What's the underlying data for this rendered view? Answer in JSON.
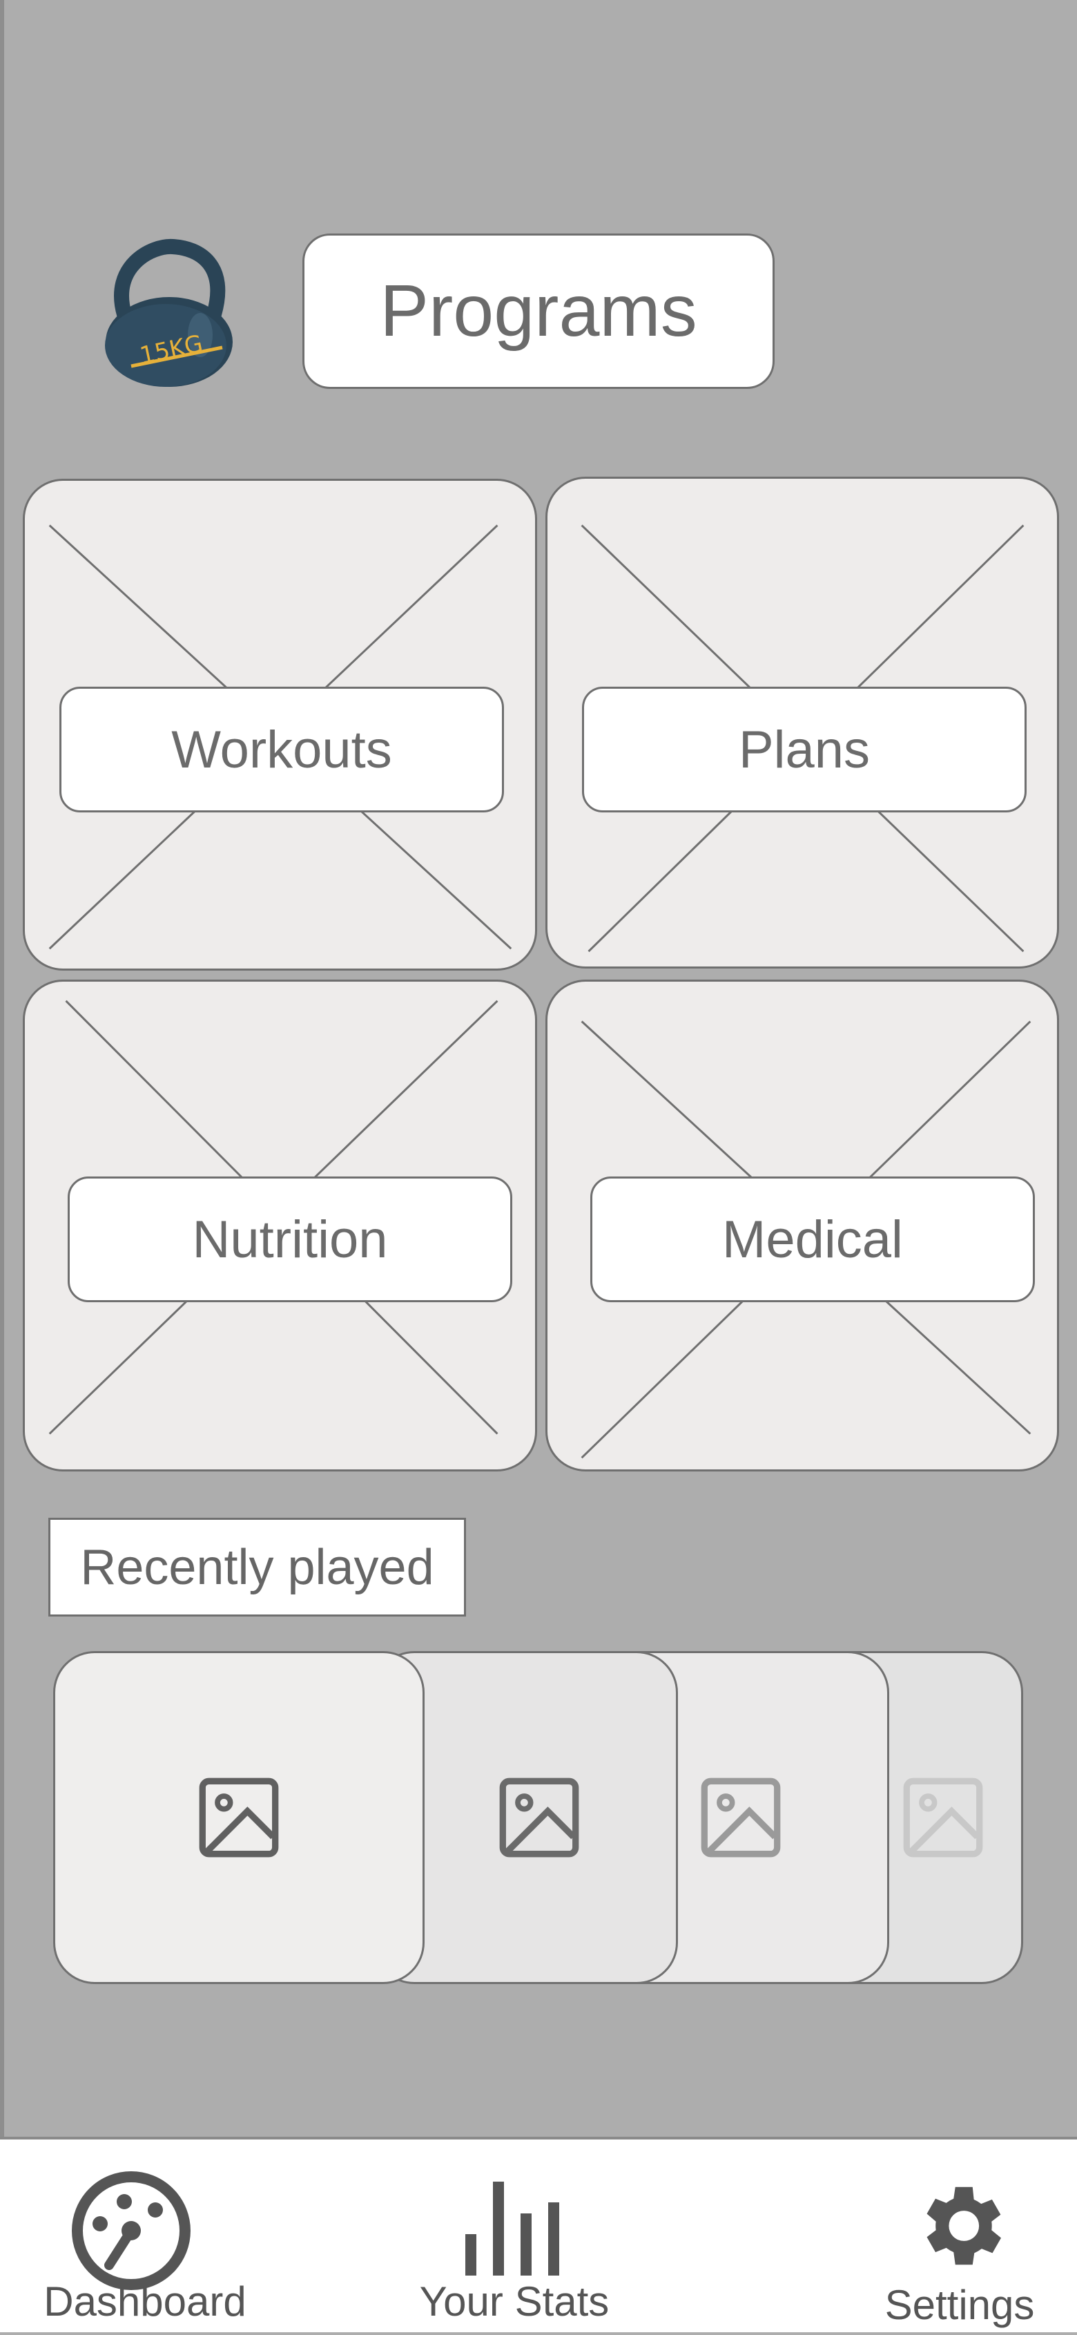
{
  "header": {
    "title": "Programs",
    "logo_text": "15KG"
  },
  "programs": [
    {
      "label": "Workouts"
    },
    {
      "label": "Plans"
    },
    {
      "label": "Nutrition"
    },
    {
      "label": "Medical"
    }
  ],
  "recently_played": {
    "label": "Recently played",
    "items": [
      "image-placeholder",
      "image-placeholder",
      "image-placeholder",
      "image-placeholder"
    ]
  },
  "nav": {
    "items": [
      {
        "label": "Dashboard",
        "icon": "dashboard-icon"
      },
      {
        "label": "Your Stats",
        "icon": "bar-chart-icon"
      },
      {
        "label": "Settings",
        "icon": "gear-icon"
      }
    ]
  },
  "colors": {
    "background": "#adadad",
    "tile": "#eeeceb",
    "border": "#6f6f6f",
    "logo_body": "#2e4a5e",
    "logo_accent": "#e6b13a"
  }
}
